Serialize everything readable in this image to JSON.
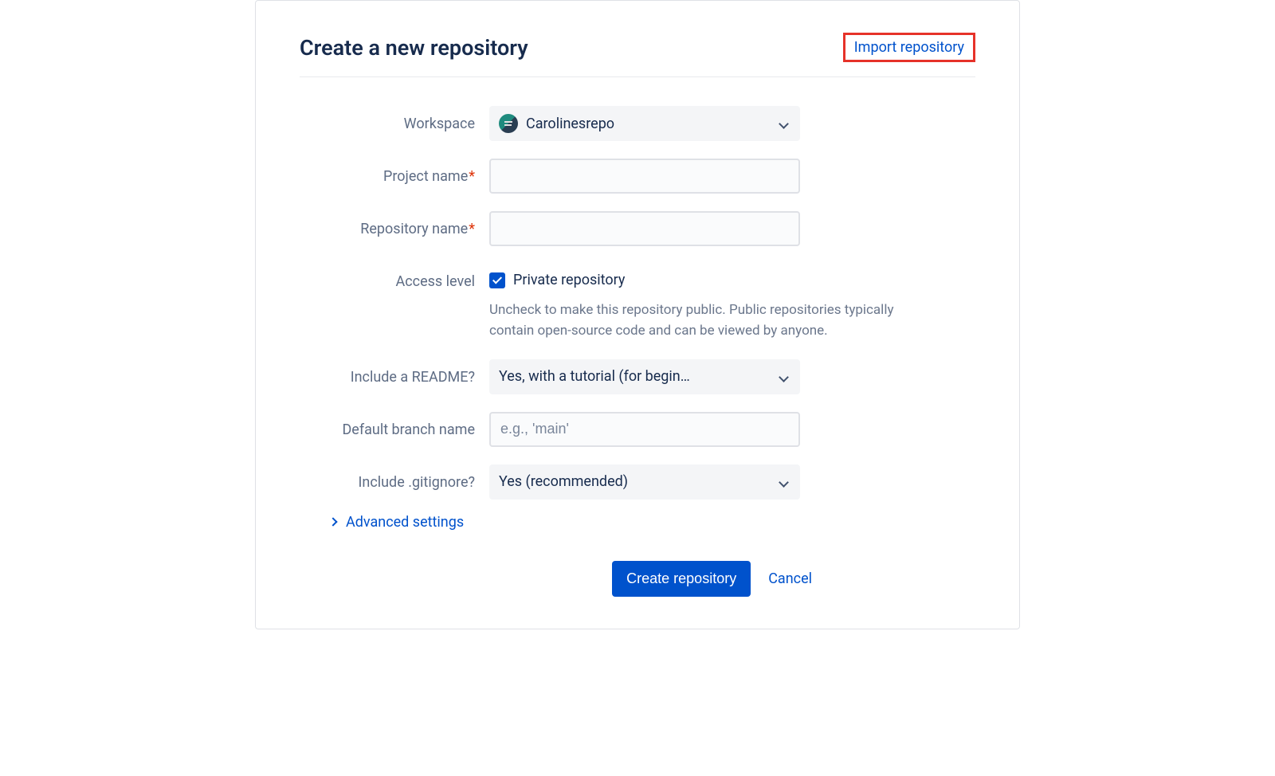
{
  "header": {
    "title": "Create a new repository",
    "import_link": "Import repository"
  },
  "form": {
    "workspace": {
      "label": "Workspace",
      "value": "Carolinesrepo"
    },
    "project_name": {
      "label": "Project name",
      "required": true,
      "value": ""
    },
    "repository_name": {
      "label": "Repository name",
      "required": true,
      "value": ""
    },
    "access_level": {
      "label": "Access level",
      "checkbox_label": "Private repository",
      "checked": true,
      "helper": "Uncheck to make this repository public. Public repositories typically contain open-source code and can be viewed by anyone."
    },
    "include_readme": {
      "label": "Include a README?",
      "value": "Yes, with a tutorial (for begin…"
    },
    "default_branch": {
      "label": "Default branch name",
      "placeholder": "e.g., 'main'",
      "value": ""
    },
    "include_gitignore": {
      "label": "Include .gitignore?",
      "value": "Yes (recommended)"
    },
    "advanced_settings": "Advanced settings"
  },
  "actions": {
    "create": "Create repository",
    "cancel": "Cancel"
  }
}
